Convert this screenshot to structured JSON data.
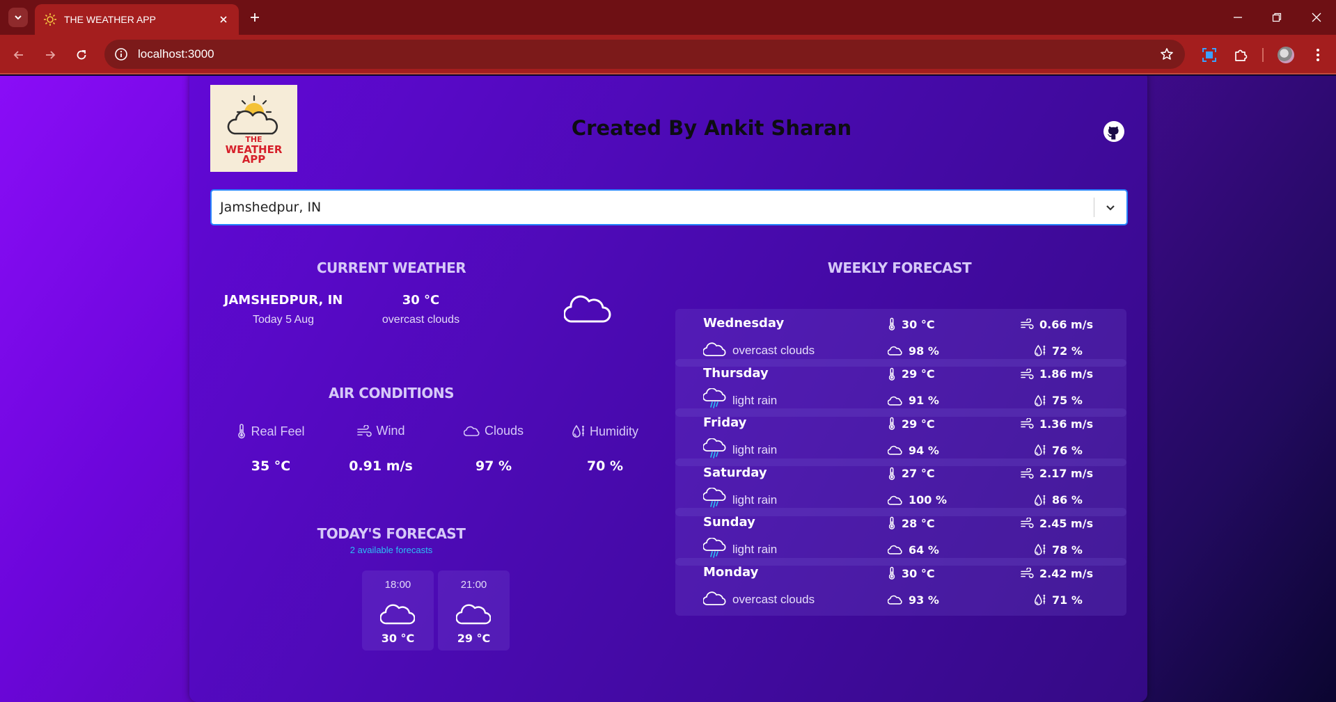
{
  "browser": {
    "tab_title": "THE WEATHER APP",
    "url": "localhost:3000"
  },
  "app": {
    "logo_lines": [
      "THE",
      "WEATHER",
      "APP"
    ],
    "creator": "Created By Ankit Sharan",
    "search_value": "Jamshedpur, IN"
  },
  "current": {
    "title": "CURRENT WEATHER",
    "city": "JAMSHEDPUR, IN",
    "date": "Today 5 Aug",
    "temp": "30 °C",
    "description": "overcast clouds",
    "icon": "cloud-icon"
  },
  "air": {
    "title": "AIR CONDITIONS",
    "items": [
      {
        "label": "Real Feel",
        "value": "35 °C",
        "icon": "thermometer-icon"
      },
      {
        "label": "Wind",
        "value": "0.91 m/s",
        "icon": "wind-icon"
      },
      {
        "label": "Clouds",
        "value": "97 %",
        "icon": "cloud-icon"
      },
      {
        "label": "Humidity",
        "value": "70 %",
        "icon": "humidity-icon"
      }
    ]
  },
  "today": {
    "title": "TODAY'S FORECAST",
    "subtitle": "2 available forecasts",
    "items": [
      {
        "time": "18:00",
        "temp": "30 °C",
        "icon": "cloud-icon"
      },
      {
        "time": "21:00",
        "temp": "29 °C",
        "icon": "cloud-icon"
      }
    ]
  },
  "weekly": {
    "title": "WEEKLY FORECAST",
    "days": [
      {
        "day": "Wednesday",
        "desc": "overcast clouds",
        "icon": "cloud-icon",
        "temp": "30 °C",
        "wind": "0.66 m/s",
        "clouds": "98 %",
        "humidity": "72 %"
      },
      {
        "day": "Thursday",
        "desc": "light rain",
        "icon": "rain-icon",
        "temp": "29 °C",
        "wind": "1.86 m/s",
        "clouds": "91 %",
        "humidity": "75 %"
      },
      {
        "day": "Friday",
        "desc": "light rain",
        "icon": "rain-icon",
        "temp": "29 °C",
        "wind": "1.36 m/s",
        "clouds": "94 %",
        "humidity": "76 %"
      },
      {
        "day": "Saturday",
        "desc": "light rain",
        "icon": "rain-icon",
        "temp": "27 °C",
        "wind": "2.17 m/s",
        "clouds": "100 %",
        "humidity": "86 %"
      },
      {
        "day": "Sunday",
        "desc": "light rain",
        "icon": "rain-icon",
        "temp": "28 °C",
        "wind": "2.45 m/s",
        "clouds": "64 %",
        "humidity": "78 %"
      },
      {
        "day": "Monday",
        "desc": "overcast clouds",
        "icon": "cloud-icon",
        "temp": "30 °C",
        "wind": "2.42 m/s",
        "clouds": "93 %",
        "humidity": "71 %"
      }
    ]
  },
  "colors": {
    "chrome_dark": "#6e1014",
    "chrome": "#a41e1e",
    "card": "#4a0ab1",
    "section_title": "#d6c9f8",
    "subtitle_accent": "#2bc0f5",
    "search_focus": "#2684ff"
  }
}
